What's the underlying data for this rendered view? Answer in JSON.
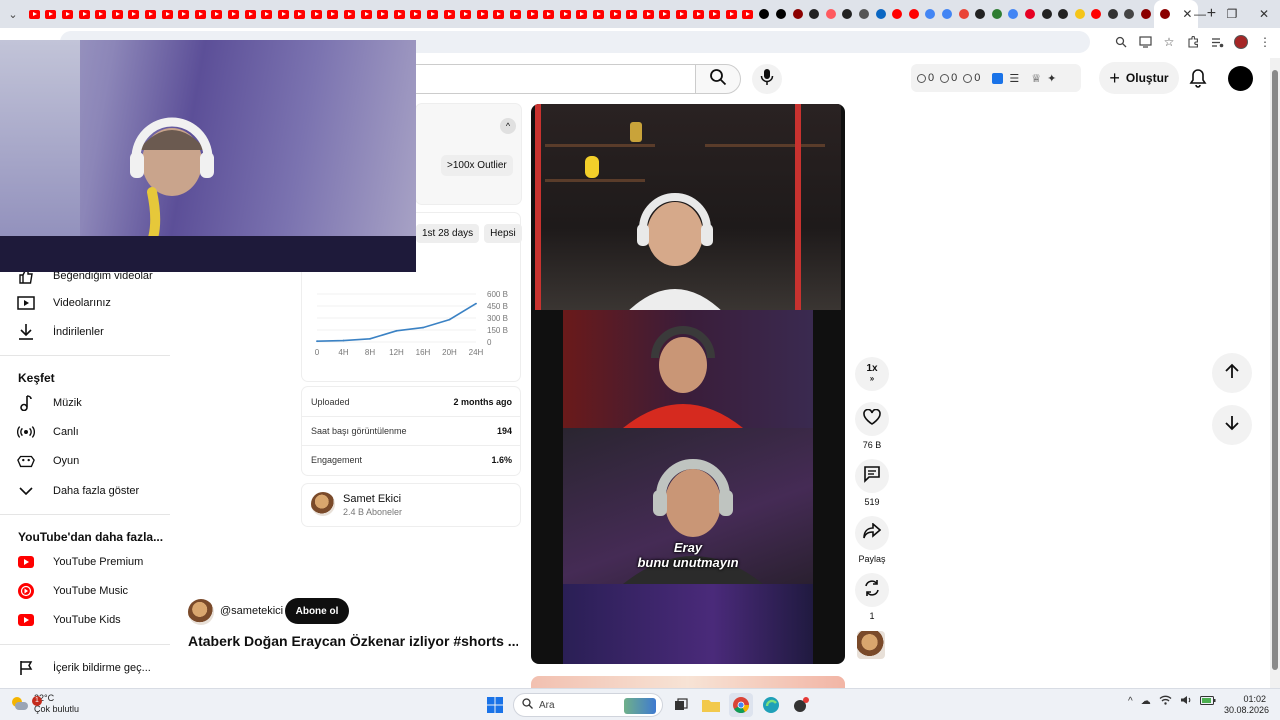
{
  "browser": {
    "tab_count_youtube": 44,
    "new_tab_symbol": "+",
    "close_tab_symbol": "✕",
    "window_controls": [
      "—",
      "❐",
      "✕"
    ]
  },
  "header": {
    "create_label": "Oluştur",
    "counters": [
      "0",
      "0",
      "0"
    ]
  },
  "sidebar": {
    "top_items": [
      {
        "label": "Beğendiğim videolar",
        "icon": "thumbs-up-icon"
      },
      {
        "label": "Videolarınız",
        "icon": "video-play-icon"
      },
      {
        "label": "İndirilenler",
        "icon": "download-icon"
      }
    ],
    "explore_heading": "Keşfet",
    "explore_items": [
      {
        "label": "Müzik",
        "icon": "music-note-icon"
      },
      {
        "label": "Canlı",
        "icon": "live-icon"
      },
      {
        "label": "Oyun",
        "icon": "gamepad-icon"
      },
      {
        "label": "Daha fazla göster",
        "icon": "chevron-down-icon"
      }
    ],
    "more_heading": "YouTube'dan daha fazla...",
    "more_items": [
      {
        "label": "YouTube Premium",
        "icon": "youtube-premium-icon"
      },
      {
        "label": "YouTube Music",
        "icon": "youtube-music-icon"
      },
      {
        "label": "YouTube Kids",
        "icon": "youtube-kids-icon"
      }
    ],
    "report_label": "İçerik bildirme geç..."
  },
  "stats": {
    "outlier_badge": ">100x Outlier",
    "range_tabs": [
      "1st 28 days",
      "Hepsi"
    ],
    "rows": [
      {
        "label": "Uploaded",
        "value": "2 months ago"
      },
      {
        "label": "Saat başı görüntülenme",
        "value": "194"
      },
      {
        "label": "Engagement",
        "value": "1.6%"
      }
    ],
    "channel_name": "Samet Ekici",
    "channel_subs": "2.4 B Aboneler"
  },
  "chart_data": {
    "type": "line",
    "x": [
      "0",
      "4H",
      "8H",
      "12H",
      "16H",
      "20H",
      "24H"
    ],
    "series": [
      {
        "values": [
          10,
          18,
          40,
          140,
          180,
          280,
          480
        ]
      }
    ],
    "y_ticks": [
      "600 B",
      "450 B",
      "300 B",
      "150 B",
      "0"
    ],
    "ylim": [
      0,
      600
    ],
    "grid": true,
    "color": "#3b82c4"
  },
  "short": {
    "caption_line1": "Eray",
    "caption_line2": "bunu unutmayın",
    "owner_handle": "@sametekici",
    "subscribe_label": "Abone ol",
    "title": "Ataberk Doğan Eraycan Özkenar izliyor #shorts ..."
  },
  "actions": {
    "speed": "1x",
    "likes": "76 B",
    "comments": "519",
    "share": "Paylaş",
    "remix": "1"
  },
  "taskbar": {
    "temperature": "22°C",
    "weather_desc": "Çok bulutlu",
    "weather_alert": "1",
    "search_placeholder": "Ara",
    "time": "01:02",
    "date": "30.08.2026"
  }
}
